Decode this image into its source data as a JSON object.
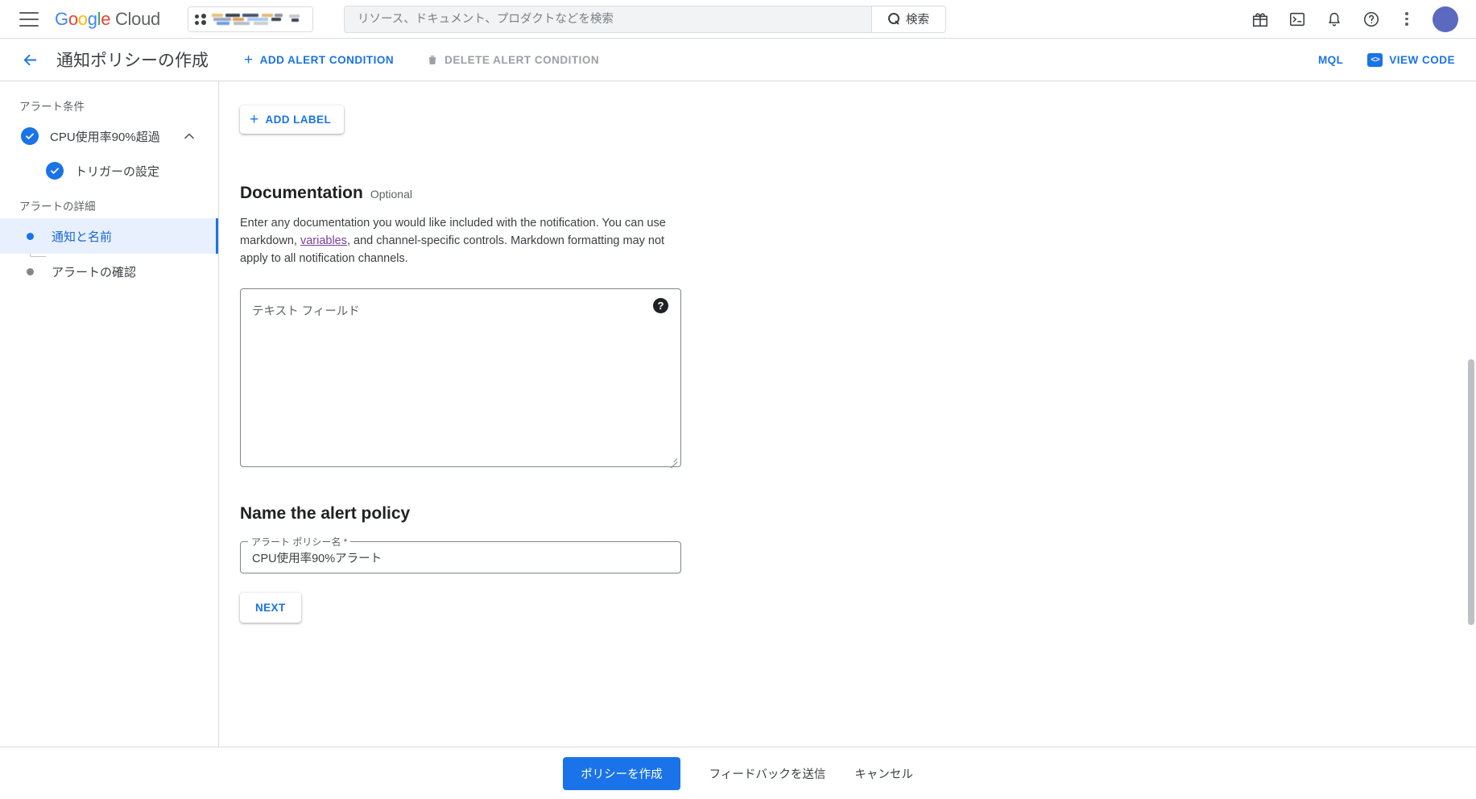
{
  "topbar": {
    "logo": {
      "g1": "G",
      "o1": "o",
      "o2": "o",
      "g2": "g",
      "l": "l",
      "e": "e",
      "cloud": "Cloud"
    },
    "project_selector_label": "",
    "search": {
      "placeholder": "リソース、ドキュメント、プロダクトなどを検索",
      "value": "",
      "button_label": "検索"
    },
    "icons": [
      "gift-icon",
      "cloud-shell-icon",
      "notifications-icon",
      "help-icon",
      "more-options-icon"
    ],
    "avatar_color": "#5b6abf"
  },
  "toolbar": {
    "title": "通知ポリシーの作成",
    "add_alert_condition": "ADD ALERT CONDITION",
    "delete_alert_condition": "DELETE ALERT CONDITION",
    "mql": "MQL",
    "view_code": "VIEW CODE",
    "accent_color": "#1a73e8",
    "disabled_color": "#9aa0a6"
  },
  "sidebar": {
    "section_condition": "アラート条件",
    "section_details": "アラートの詳細",
    "items": [
      {
        "label": "CPU使用率90%超過",
        "state": "complete",
        "expanded": true
      },
      {
        "label": "トリガーの設定",
        "state": "complete"
      },
      {
        "label": "通知と名前",
        "state": "active"
      },
      {
        "label": "アラートの確認",
        "state": "pending"
      }
    ]
  },
  "main": {
    "add_label_button": "ADD LABEL",
    "documentation": {
      "heading": "Documentation",
      "optional_tag": "Optional",
      "description_part1": "Enter any documentation you would like included with the notification. You can use markdown, ",
      "description_link": "variables",
      "description_part2": ", and channel-specific controls. Markdown formatting may not apply to all notification channels.",
      "textarea_placeholder": "テキスト フィールド",
      "textarea_value": "",
      "help_glyph": "?"
    },
    "name_section": {
      "heading": "Name the alert policy",
      "field_label": "アラート ポリシー名 *",
      "field_value": "CPU使用率90%アラート"
    },
    "next_button": "NEXT"
  },
  "footer": {
    "create_policy": "ポリシーを作成",
    "send_feedback": "フィードバックを送信",
    "cancel": "キャンセル"
  }
}
